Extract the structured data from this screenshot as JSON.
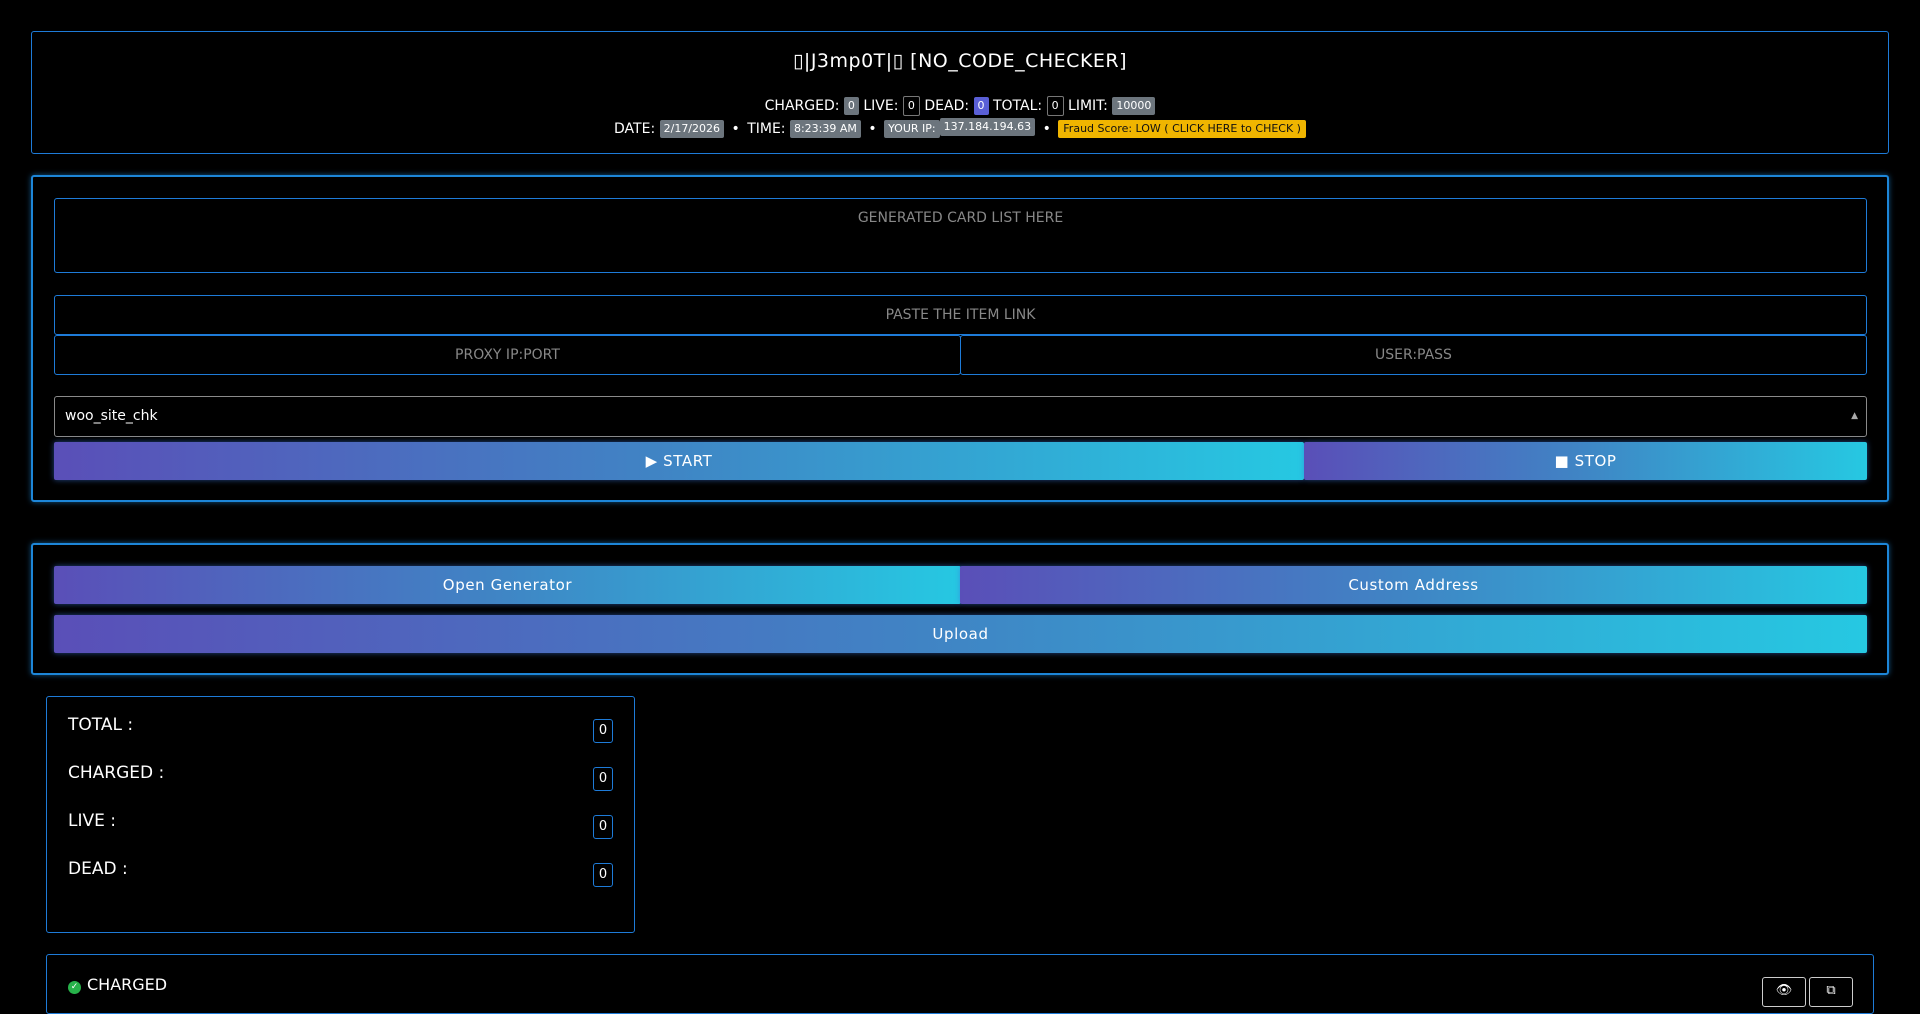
{
  "header": {
    "title": "▯|J3mp0T|▯ [NO_CODE_CHECKER]",
    "charged_label": "CHARGED:",
    "charged_value": "0",
    "live_label": "LIVE:",
    "live_value": "0",
    "dead_label": "DEAD:",
    "dead_value": "0",
    "total_label": "TOTAL:",
    "total_value": "0",
    "limit_label": "LIMIT:",
    "limit_value": "10000",
    "date_label": "DATE:",
    "date_value": "2/17/2026",
    "time_label": "TIME:",
    "time_value": "8:23:39 AM",
    "ip_label": "YOUR IP:",
    "ip_value": "137.184.194.63",
    "fraud_text": "Fraud Score: LOW ( CLICK HERE to CHECK )",
    "bullet": "•"
  },
  "checker": {
    "cardlist_placeholder": "GENERATED CARD LIST HERE",
    "itemlink_placeholder": "PASTE THE ITEM LINK",
    "proxy_placeholder": "PROXY IP:PORT",
    "userpass_placeholder": "USER:PASS",
    "gate_selected": "woo_site_chk",
    "start_label": "▶ START",
    "stop_label": "■ STOP"
  },
  "tools": {
    "generator_label": "Open Generator",
    "address_label": "Custom Address",
    "upload_label": "Upload"
  },
  "stats": {
    "rows": [
      {
        "label": "TOTAL :",
        "value": "0"
      },
      {
        "label": "CHARGED :",
        "value": "0"
      },
      {
        "label": "LIVE :",
        "value": "0"
      },
      {
        "label": "DEAD :",
        "value": "0"
      }
    ]
  },
  "charged_panel": {
    "title": "CHARGED",
    "check_icon": "check-circle-icon",
    "eye_icon": "eye-slash-icon",
    "copy_icon": "copy-icon"
  },
  "colors": {
    "border": "#1e7bd8",
    "gradient_start": "#5a4fb8",
    "gradient_end": "#26c8e2",
    "fraud_badge": "#f0b500",
    "dead_badge": "#5a5fd6"
  }
}
